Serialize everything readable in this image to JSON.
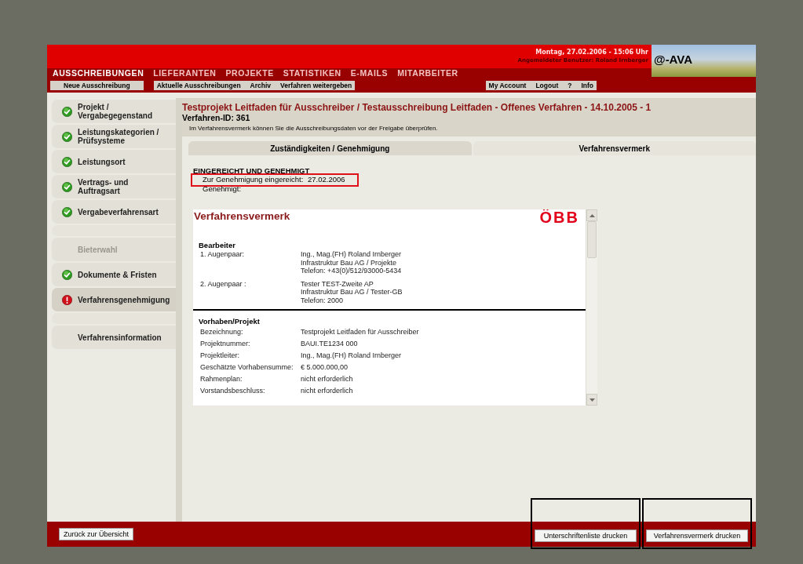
{
  "header": {
    "date": "Montag, 27.02.2006 - 15:06 Uhr",
    "user": "Angemeldeter Benutzer: Roland Irnberger",
    "logo": "@-AVA"
  },
  "nav": [
    {
      "label": "AUSSCHREIBUNGEN",
      "selected": true
    },
    {
      "label": "LIEFERANTEN",
      "selected": false
    },
    {
      "label": "PROJEKTE",
      "selected": false
    },
    {
      "label": "STATISTIKEN",
      "selected": false
    },
    {
      "label": "E-MAILS",
      "selected": false
    },
    {
      "label": "MITARBEITER",
      "selected": false
    }
  ],
  "subnav": {
    "left": [
      [
        "Neue Ausschreibung"
      ],
      [
        "Aktuelle Ausschreibungen",
        "Archiv",
        "Verfahren weitergeben"
      ]
    ],
    "right": [
      [
        "My Account",
        "Logout",
        "?",
        "Info"
      ]
    ]
  },
  "sidebar": {
    "items": [
      {
        "kind": "step",
        "label": "Projekt / Vergabegegenstand",
        "checked": true,
        "error": false,
        "selected": false,
        "disabled": false
      },
      {
        "kind": "step",
        "label": "Leistungskategorien / Prüfsysteme",
        "checked": true,
        "error": false,
        "selected": false,
        "disabled": false
      },
      {
        "kind": "step",
        "label": "Leistungsort",
        "checked": true,
        "error": false,
        "selected": false,
        "disabled": false
      },
      {
        "kind": "step",
        "label": "Vertrags- und Auftragsart",
        "checked": true,
        "error": false,
        "selected": false,
        "disabled": false
      },
      {
        "kind": "step",
        "label": "Vergabeverfahrensart",
        "checked": true,
        "error": false,
        "selected": false,
        "disabled": false
      },
      {
        "kind": "spacer"
      },
      {
        "kind": "step",
        "label": "Bieterwahl",
        "checked": false,
        "error": false,
        "selected": false,
        "disabled": true
      },
      {
        "kind": "step",
        "label": "Dokumente & Fristen",
        "checked": true,
        "error": false,
        "selected": false,
        "disabled": false
      },
      {
        "kind": "step",
        "label": "Verfahrensgenehmigung",
        "checked": false,
        "error": true,
        "selected": true,
        "disabled": false
      },
      {
        "kind": "spacer"
      },
      {
        "kind": "step",
        "label": "Verfahrensinformation",
        "checked": false,
        "error": false,
        "selected": false,
        "disabled": false
      }
    ]
  },
  "main": {
    "title": "Testprojekt Leitfaden für Ausschreiber / Testausschreibung Leitfaden - Offenes Verfahren - 14.10.2005 - 1",
    "procedure_id": "Verfahren-ID: 361",
    "hint": "Im Verfahrensvermerk können Sie die Ausschreibungsdaten vor der Freigabe überprüfen.",
    "tabs": [
      {
        "label": "Zuständigkeiten / Genehmigung",
        "selected": false
      },
      {
        "label": "Verfahrensvermerk",
        "selected": true
      }
    ],
    "status": {
      "heading": "EINGEREICHT UND GENEHMIGT",
      "rows": [
        {
          "label": "Zur Genehmigung eingereicht:",
          "value": "27.02.2006",
          "highlighted": true
        },
        {
          "label": "Genehmigt:",
          "highlighted": false
        }
      ]
    },
    "document": {
      "title": "Verfahrensvermerk",
      "logo": "ÖBB",
      "sections": [
        {
          "heading": "Bearbeiter",
          "rows": [
            {
              "label": "1. Augenpaar:",
              "lines": [
                "Ing., Mag.(FH) Roland Irnberger",
                "Infrastruktur Bau AG / Projekte",
                "Telefon: +43(0)/512/93000-5434"
              ]
            },
            {
              "label": "2. Augenpaar :",
              "lines": [
                "Tester TEST-Zweite AP",
                "Infrastruktur Bau AG / Tester-GB",
                "Telefon: 2000"
              ]
            }
          ]
        },
        {
          "heading": "Vorhaben/Projekt",
          "rows": [
            {
              "label": "Bezeichnung:",
              "value": "Testprojekt Leitfaden für Ausschreiber"
            },
            {
              "label": "Projektnummer:",
              "value": "BAUI.TE1234 000"
            },
            {
              "label": "Projektleiter:",
              "value": "Ing., Mag.(FH) Roland Irnberger"
            },
            {
              "label": "Geschätzte Vorhabensumme:",
              "value": "€ 5.000.000,00"
            },
            {
              "label": "Rahmenplan:",
              "value": "nicht erforderlich"
            },
            {
              "label": "Vorstandsbeschluss:",
              "value": "nicht erforderlich"
            }
          ]
        }
      ]
    }
  },
  "footer": {
    "back_button": "Zurück zur Übersicht",
    "print_buttons": [
      {
        "label": "Unterschriftenliste drucken",
        "highlighted": true
      },
      {
        "label": "Verfahrensvermerk drucken",
        "highlighted": true
      }
    ]
  }
}
